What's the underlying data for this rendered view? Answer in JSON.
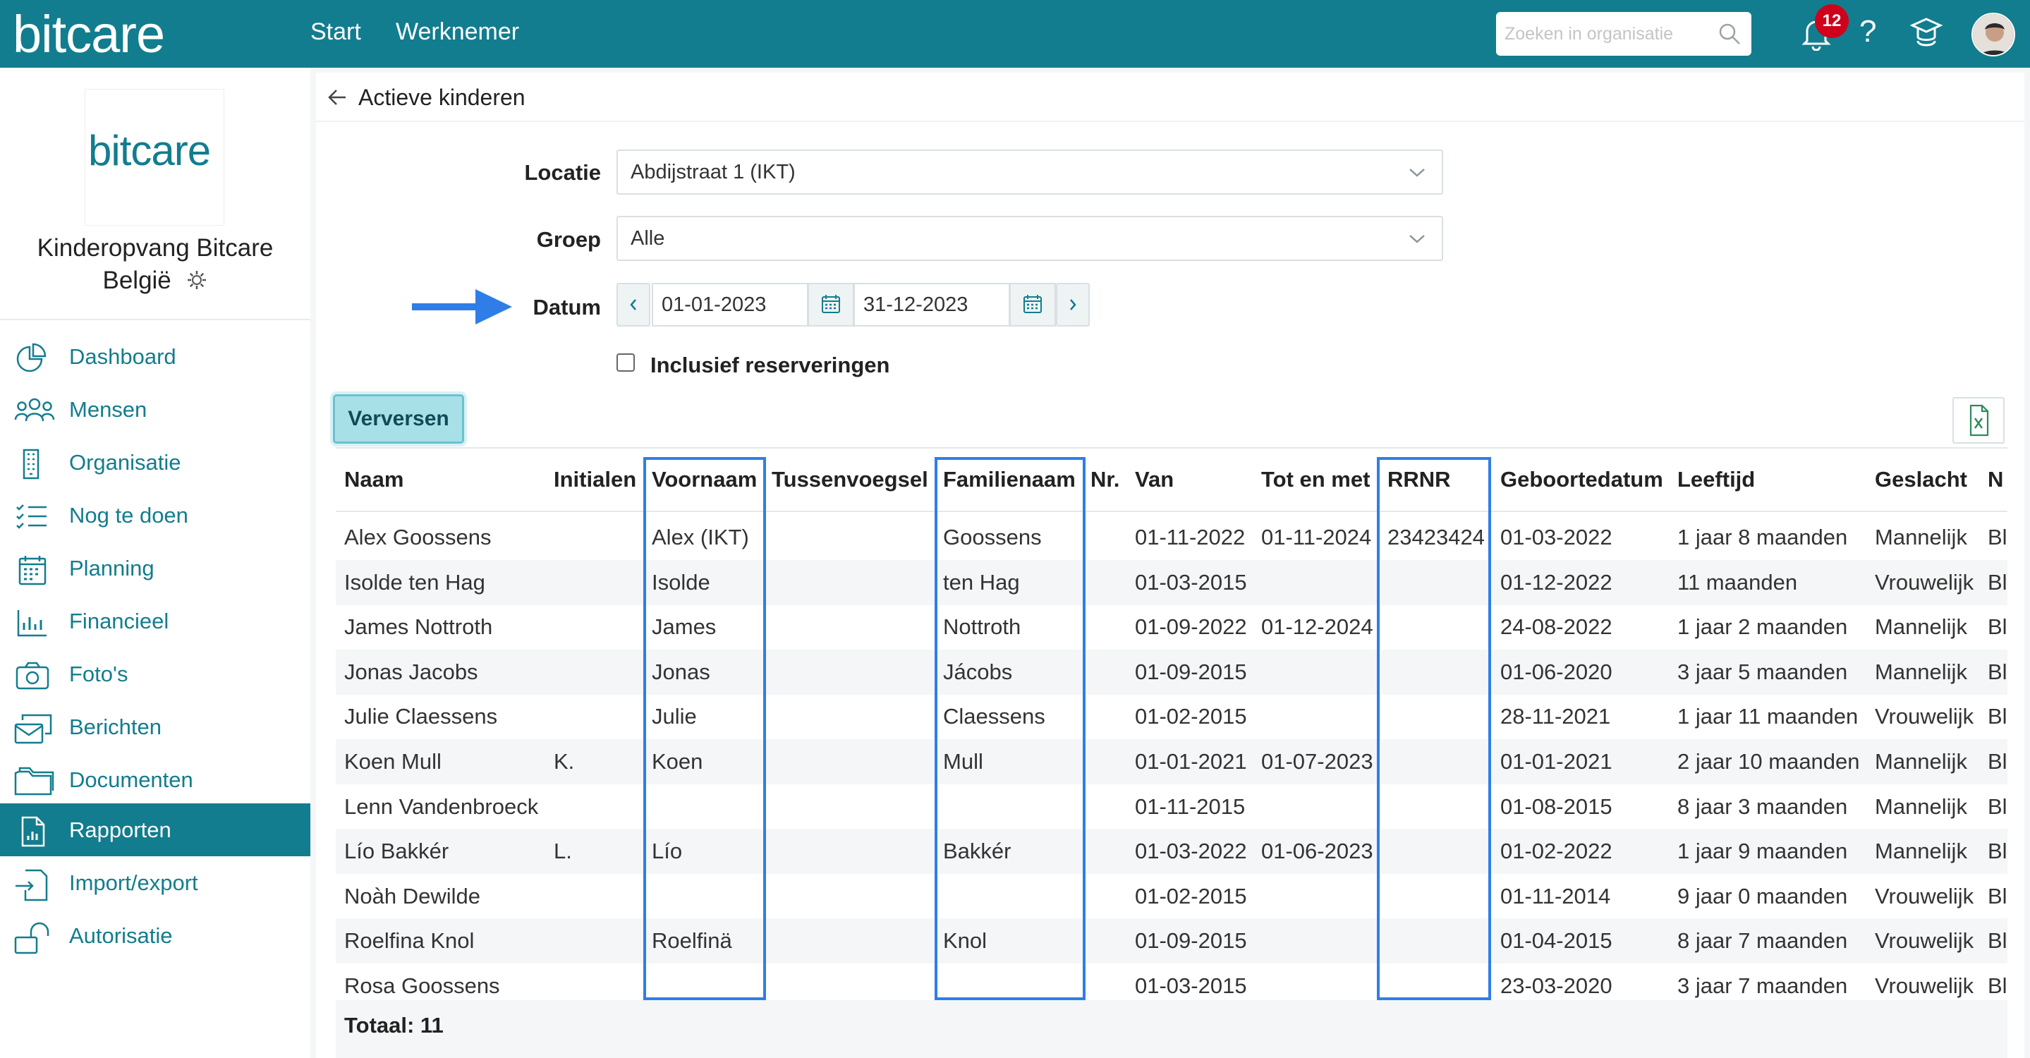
{
  "topbar": {
    "logo": "bitcare",
    "nav": [
      {
        "label": "Start"
      },
      {
        "label": "Werknemer"
      }
    ],
    "search_placeholder": "Zoeken in organisatie",
    "notification_count": "12",
    "help_label": "?"
  },
  "sidebar": {
    "org_logo": "bitcare",
    "org_name_line1": "Kinderopvang Bitcare",
    "org_name_line2": "België",
    "items": [
      {
        "label": "Dashboard",
        "icon": "pie-chart-icon"
      },
      {
        "label": "Mensen",
        "icon": "people-icon"
      },
      {
        "label": "Organisatie",
        "icon": "building-icon"
      },
      {
        "label": "Nog te doen",
        "icon": "checklist-icon"
      },
      {
        "label": "Planning",
        "icon": "calendar-icon"
      },
      {
        "label": "Financieel",
        "icon": "bar-chart-icon"
      },
      {
        "label": "Foto's",
        "icon": "camera-icon"
      },
      {
        "label": "Berichten",
        "icon": "messages-icon"
      },
      {
        "label": "Documenten",
        "icon": "folder-icon"
      },
      {
        "label": "Rapporten",
        "icon": "report-icon",
        "active": true
      },
      {
        "label": "Import/export",
        "icon": "import-export-icon"
      },
      {
        "label": "Autorisatie",
        "icon": "lock-icon"
      }
    ]
  },
  "page": {
    "title": "Actieve kinderen",
    "filters": {
      "locatie_label": "Locatie",
      "locatie_value": "Abdijstraat 1 (IKT)",
      "groep_label": "Groep",
      "groep_value": "Alle",
      "datum_label": "Datum",
      "date_from": "01-01-2023",
      "date_to": "31-12-2023",
      "include_reservations_label": "Inclusief reserveringen",
      "include_reservations_checked": false
    },
    "refresh_label": "Verversen"
  },
  "table": {
    "columns": [
      "Naam",
      "Initialen",
      "Voornaam",
      "Tussenvoegsel",
      "Familienaam",
      "Nr.",
      "Van",
      "Tot en met",
      "RRNR",
      "Geboortedatum",
      "Leeftijd",
      "Geslacht",
      "N"
    ],
    "rows": [
      [
        "Alex Goossens",
        "",
        "Alex (IKT)",
        "",
        "Goossens",
        "",
        "01-11-2022",
        "01-11-2024",
        "23423424",
        "01-03-2022",
        "1 jaar 8 maanden",
        "Mannelijk",
        "Bl"
      ],
      [
        "Isolde ten Hag",
        "",
        "Isolde",
        "",
        "ten Hag",
        "",
        "01-03-2015",
        "",
        "",
        "01-12-2022",
        "11 maanden",
        "Vrouwelijk",
        "Bl"
      ],
      [
        "James Nottroth",
        "",
        "James",
        "",
        "Nottroth",
        "",
        "01-09-2022",
        "01-12-2024",
        "",
        "24-08-2022",
        "1 jaar 2 maanden",
        "Mannelijk",
        "Bl"
      ],
      [
        "Jonas Jacobs",
        "",
        "Jonas",
        "",
        "Jácobs",
        "",
        "01-09-2015",
        "",
        "",
        "01-06-2020",
        "3 jaar 5 maanden",
        "Mannelijk",
        "Bl"
      ],
      [
        "Julie Claessens",
        "",
        "Julie",
        "",
        "Claessens",
        "",
        "01-02-2015",
        "",
        "",
        "28-11-2021",
        "1 jaar 11 maanden",
        "Vrouwelijk",
        "Bl"
      ],
      [
        "Koen Mull",
        "K.",
        "Koen",
        "",
        "Mull",
        "",
        "01-01-2021",
        "01-07-2023",
        "",
        "01-01-2021",
        "2 jaar 10 maanden",
        "Mannelijk",
        "Bl"
      ],
      [
        "Lenn Vandenbroeck",
        "",
        "",
        "",
        "",
        "",
        "01-11-2015",
        "",
        "",
        "01-08-2015",
        "8 jaar 3 maanden",
        "Mannelijk",
        "Bl"
      ],
      [
        "Lío Bakkér",
        "L.",
        "Lío",
        "",
        "Bakkér",
        "",
        "01-03-2022",
        "01-06-2023",
        "",
        "01-02-2022",
        "1 jaar 9 maanden",
        "Mannelijk",
        "Bl"
      ],
      [
        "Noàh Dewilde",
        "",
        "",
        "",
        "",
        "",
        "01-02-2015",
        "",
        "",
        "01-11-2014",
        "9 jaar 0 maanden",
        "Vrouwelijk",
        "Bl"
      ],
      [
        "Roelfina Knol",
        "",
        "Roelfinä",
        "",
        "Knol",
        "",
        "01-09-2015",
        "",
        "",
        "01-04-2015",
        "8 jaar 7 maanden",
        "Vrouwelijk",
        "Bl"
      ],
      [
        "Rosa Goossens",
        "",
        "",
        "",
        "",
        "",
        "01-03-2015",
        "",
        "",
        "23-03-2020",
        "3 jaar 7 maanden",
        "Vrouwelijk",
        "Bl"
      ]
    ],
    "total": "Totaal: 11"
  },
  "colors": {
    "brand": "#127d8e",
    "highlight": "#2f7ee8",
    "badge": "#d0021b"
  }
}
